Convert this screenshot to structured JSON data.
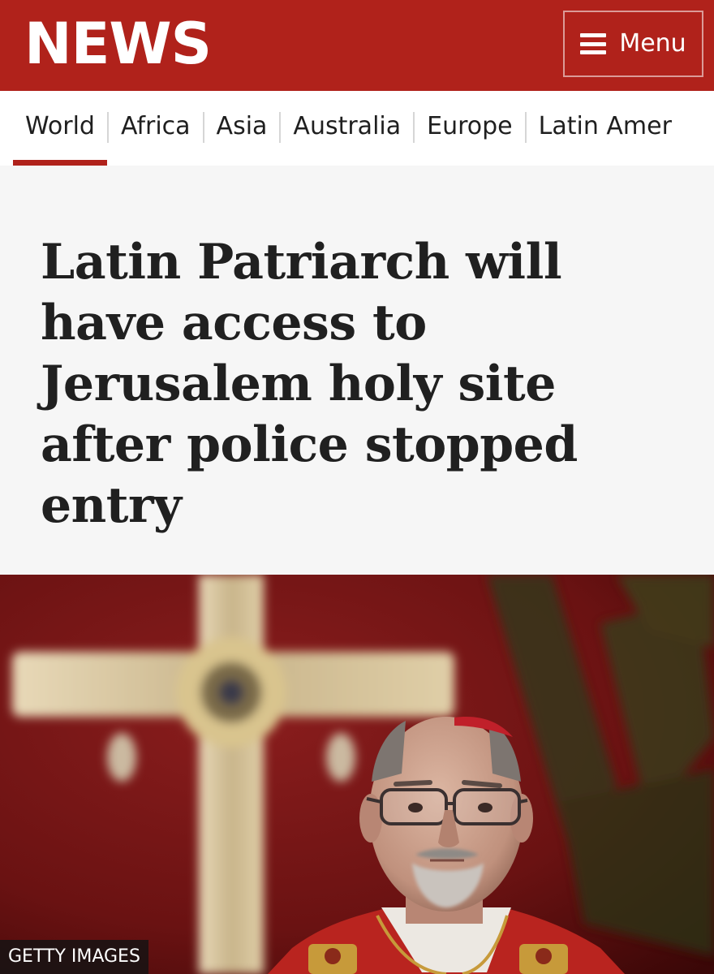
{
  "header": {
    "logo": "NEWS",
    "menu_label": "Menu",
    "menu_icon": "hamburger-icon",
    "background_color": "#b0221b"
  },
  "nav": {
    "items": [
      {
        "label": "World",
        "active": true
      },
      {
        "label": "Africa",
        "active": false
      },
      {
        "label": "Asia",
        "active": false
      },
      {
        "label": "Australia",
        "active": false
      },
      {
        "label": "Europe",
        "active": false
      },
      {
        "label": "Latin Amer",
        "active": false
      }
    ],
    "accent_color": "#b0221b"
  },
  "article": {
    "headline": "Latin Patriarch will have access to Jerusalem holy site after police stopped entry"
  },
  "photo": {
    "credit": "GETTY IMAGES"
  }
}
